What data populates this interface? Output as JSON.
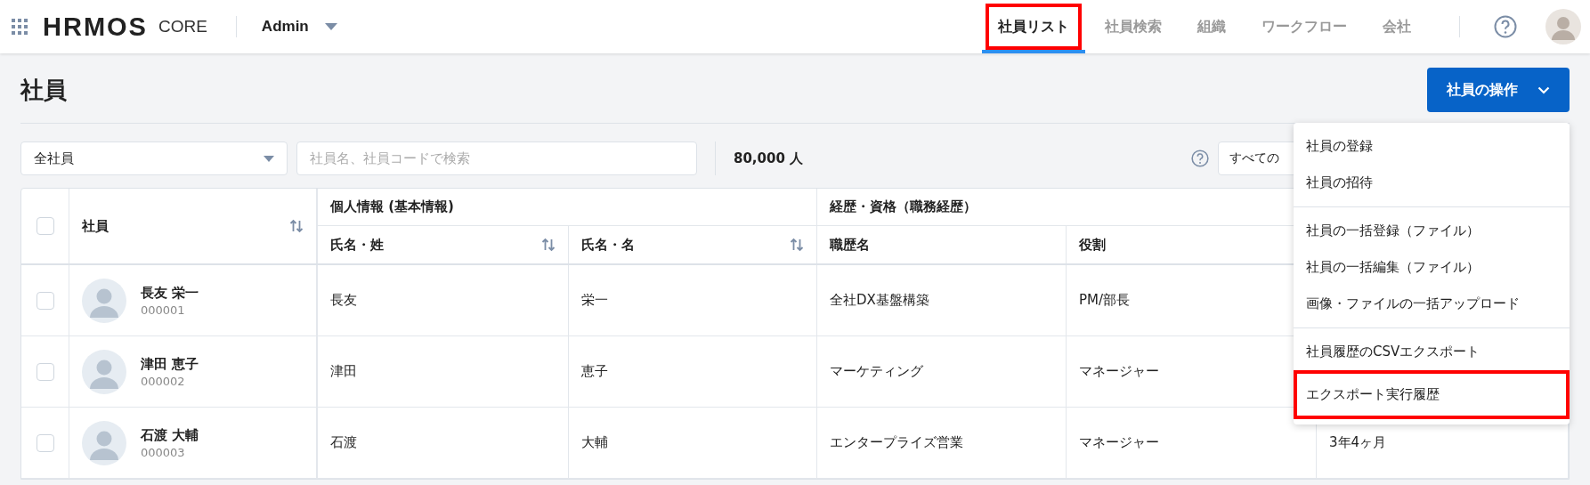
{
  "header": {
    "logo": "HRMOS",
    "product": "CORE",
    "workspace": "Admin",
    "nav": [
      {
        "label": "社員リスト",
        "selected": true,
        "highlighted": true
      },
      {
        "label": "社員検索",
        "selected": false,
        "highlighted": false
      },
      {
        "label": "組織",
        "selected": false,
        "highlighted": false
      },
      {
        "label": "ワークフロー",
        "selected": false,
        "highlighted": false
      },
      {
        "label": "会社",
        "selected": false,
        "highlighted": false
      }
    ]
  },
  "page": {
    "title": "社員",
    "action_button": "社員の操作"
  },
  "filters": {
    "group_select": "全社員",
    "search_placeholder": "社員名、社員コードで検索",
    "count": "80,000 人",
    "view_select": "すべての"
  },
  "table": {
    "header_checked": false,
    "groups": [
      {
        "label": "個人情報 (基本情報)"
      },
      {
        "label": "経歴・資格（職務経歴）"
      }
    ],
    "employee_column": {
      "label": "社員",
      "sortable": true
    },
    "columns": [
      {
        "label": "氏名・姓",
        "sortable": true
      },
      {
        "label": "氏名・名",
        "sortable": true
      },
      {
        "label": "職歴名",
        "sortable": false
      },
      {
        "label": "役割",
        "sortable": false
      }
    ],
    "rows": [
      {
        "checked": false,
        "name": "長友 栄一",
        "code": "000001",
        "cells": [
          "長友",
          "栄一",
          "全社DX基盤構築",
          "PM/部長"
        ]
      },
      {
        "checked": false,
        "name": "津田 恵子",
        "code": "000002",
        "cells": [
          "津田",
          "恵子",
          "マーケティング",
          "マネージャー"
        ]
      },
      {
        "checked": false,
        "name": "石渡 大輔",
        "code": "000003",
        "cells": [
          "石渡",
          "大輔",
          "エンタープライズ営業",
          "マネージャー"
        ],
        "column_7": "3年4ヶ月"
      }
    ]
  },
  "menu": {
    "sections": [
      [
        {
          "label": "社員の登録",
          "highlighted": false
        },
        {
          "label": "社員の招待",
          "highlighted": false
        }
      ],
      [
        {
          "label": "社員の一括登録（ファイル）",
          "highlighted": false
        },
        {
          "label": "社員の一括編集（ファイル）",
          "highlighted": false
        },
        {
          "label": "画像・ファイルの一括アップロード",
          "highlighted": false
        }
      ],
      [
        {
          "label": "社員履歴のCSVエクスポート",
          "highlighted": false
        },
        {
          "label": "エクスポート実行履歴",
          "highlighted": true
        }
      ]
    ]
  }
}
